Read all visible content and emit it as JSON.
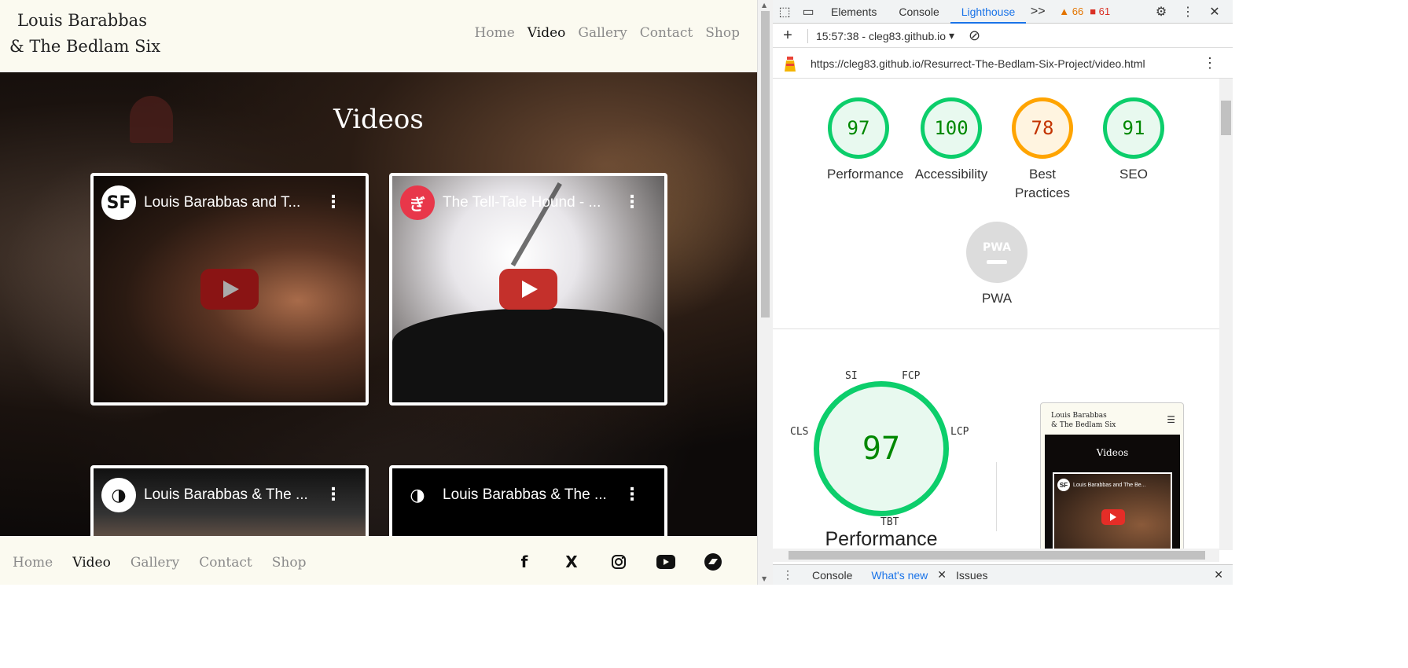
{
  "site": {
    "logo_line1": "Louis Barabbas",
    "logo_line2": "& The Bedlam Six",
    "nav": [
      "Home",
      "Video",
      "Gallery",
      "Contact",
      "Shop"
    ],
    "active_nav": "Video",
    "hero_title": "Videos",
    "videos": [
      {
        "channel_icon": "SF",
        "title": "Louis Barabbas and T...",
        "play": "youtube-play-icon"
      },
      {
        "channel_icon": "ぎ",
        "title": "The Tell-Tale Hound - ...",
        "play": "youtube-play-icon"
      },
      {
        "channel_icon": "◑",
        "title": "Louis Barabbas & The ...",
        "play": "youtube-play-icon"
      },
      {
        "channel_icon": "◑",
        "title": "Louis Barabbas & The ...",
        "play": "youtube-play-icon"
      }
    ],
    "footer_nav": [
      "Home",
      "Video",
      "Gallery",
      "Contact",
      "Shop"
    ],
    "social": [
      "facebook-icon",
      "x-icon",
      "instagram-icon",
      "youtube-icon",
      "bandcamp-icon"
    ]
  },
  "devtools": {
    "tabs": [
      "Elements",
      "Console",
      "Lighthouse"
    ],
    "active_tab": "Lighthouse",
    "more": ">>",
    "warnings": "66",
    "errors": "61",
    "report_time": "15:57:38 - cleg83.github.io",
    "url": "https://cleg83.github.io/Resurrect-The-Bedlam-Six-Project/video.html",
    "scores": [
      {
        "label": "Performance",
        "value": "97",
        "status": "pass"
      },
      {
        "label": "Accessibility",
        "value": "100",
        "status": "pass"
      },
      {
        "label": "Best Practices",
        "value": "78",
        "status": "average"
      },
      {
        "label": "SEO",
        "value": "91",
        "status": "pass"
      }
    ],
    "pwa_label": "PWA",
    "pwa_icon": "PWA",
    "big_score": "97",
    "big_label": "Performance",
    "metrics": [
      "SI",
      "FCP",
      "LCP",
      "TBT",
      "CLS"
    ],
    "preview": {
      "logo_line1": "Louis Barabbas",
      "logo_line2": "& The Bedlam Six",
      "title": "Videos",
      "video_title": "Louis Barabbas and The Be...",
      "channel": "SF"
    },
    "drawer_tabs": [
      "Console",
      "What's new",
      "Issues"
    ],
    "colors": {
      "accent": "#1a73e8",
      "pass": "#0cce6b",
      "average": "#ffa400"
    }
  }
}
